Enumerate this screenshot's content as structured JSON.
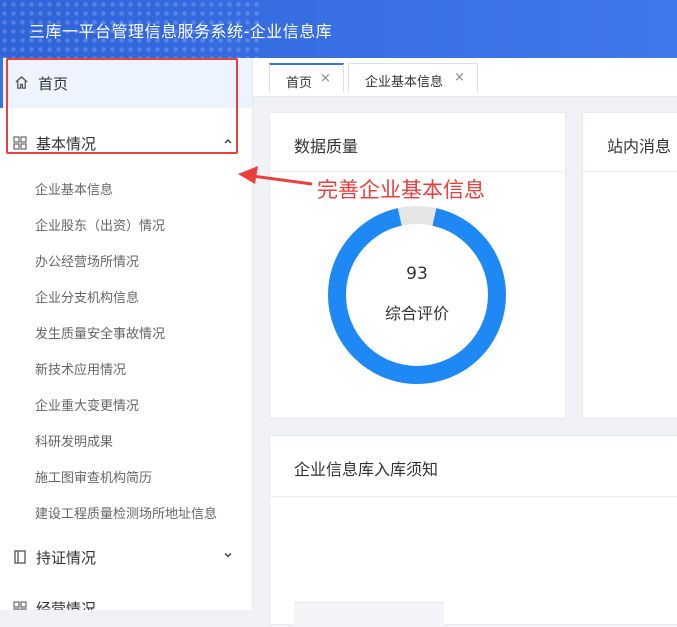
{
  "header": {
    "title": "三库一平台管理信息服务系统-企业信息库"
  },
  "sidebar": {
    "home": {
      "label": "首页",
      "icon": "home-icon"
    },
    "groups": [
      {
        "label": "基本情况",
        "icon": "grid-icon",
        "expanded": true,
        "items": [
          "企业基本信息",
          "企业股东（出资）情况",
          "办公经营场所情况",
          "企业分支机构信息",
          "发生质量安全事故情况",
          "新技术应用情况",
          "企业重大变更情况",
          "科研发明成果",
          "施工图审查机构简历",
          "建设工程质量检测场所地址信息"
        ]
      },
      {
        "label": "持证情况",
        "icon": "book-icon",
        "expanded": false
      },
      {
        "label": "经营情况",
        "icon": "grid-icon",
        "expanded": false
      }
    ]
  },
  "tabs": [
    {
      "label": "首页",
      "active": true
    },
    {
      "label": "企业基本信息",
      "active": false
    }
  ],
  "cards": {
    "data_quality": {
      "title": "数据质量",
      "score": "93",
      "score_label": "综合评价",
      "score_fraction": 0.93
    },
    "messages": {
      "title": "站内消息"
    },
    "notice": {
      "title": "企业信息库入库须知"
    }
  },
  "annotation": {
    "text": "完善企业基本信息"
  },
  "colors": {
    "accent": "#3a72e6",
    "ring": "#1e88f5",
    "ring_track": "#e6e6e6",
    "highlight": "#e8403a"
  }
}
